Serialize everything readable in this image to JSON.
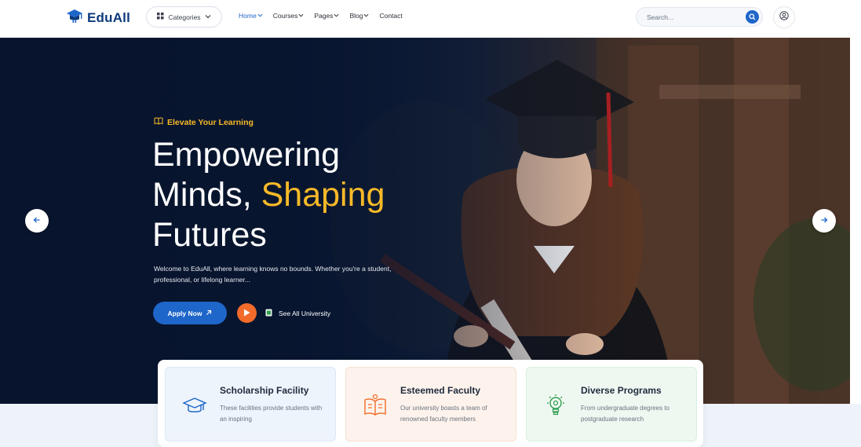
{
  "header": {
    "logo_text": "EduAll",
    "categories_label": "Categories",
    "nav": [
      {
        "label": "Home"
      },
      {
        "label": "Courses"
      },
      {
        "label": "Pages"
      },
      {
        "label": "Blog"
      },
      {
        "label": "Contact"
      }
    ],
    "search_placeholder": "Search..."
  },
  "hero": {
    "tagline": "Elevate Your Learning",
    "headline_line1": "Empowering",
    "headline_line2_plain": "Minds, ",
    "headline_line2_accent": "Shaping",
    "headline_line3": "Futures",
    "lead": "Welcome to EduAll, where learning knows no bounds. Whether you're a student, professional, or lifelong learner...",
    "apply_label": "Apply Now",
    "see_all_label": "See All University"
  },
  "features": [
    {
      "title": "Scholarship Facility",
      "desc": "These facilities provide students with an inspiring",
      "icon": "graduation-cap-icon"
    },
    {
      "title": "Esteemed Faculty",
      "desc": "Our university boasts a team of renowned faculty members",
      "icon": "faculty-book-icon"
    },
    {
      "title": "Diverse Programs",
      "desc": "From undergraduate degrees to postgraduate research",
      "icon": "idea-bulb-icon"
    }
  ],
  "colors": {
    "primary": "#1e66c9",
    "accent": "#f7b928",
    "play": "#f26b2a",
    "navy": "#0b1a38"
  }
}
